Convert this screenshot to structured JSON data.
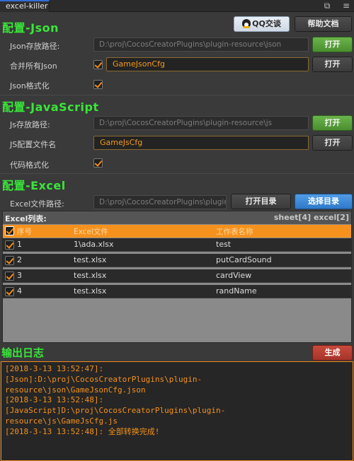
{
  "window": {
    "tab_title": "excel-killer"
  },
  "json_section": {
    "title": "配置-Json",
    "qq_button": "QQ交谈",
    "help_button": "帮助文档",
    "save_path_label": "Json存放路径:",
    "save_path_value": "D:\\proj\\CocosCreatorPlugins\\plugin-resource\\json",
    "open_button": "打开",
    "merge_label": "合并所有Json",
    "merge_name_value": "GameJsonCfg",
    "open_button_2": "打开",
    "format_label": "Json格式化"
  },
  "js_section": {
    "title": "配置-JavaScript",
    "save_path_label": "Js存放路径:",
    "save_path_value": "D:\\proj\\CocosCreatorPlugins\\plugin-resource\\js",
    "open_button": "打开",
    "config_name_label": "JS配置文件名",
    "config_name_value": "GameJsCfg",
    "open_button_2": "打开",
    "format_label": "代码格式化"
  },
  "excel_section": {
    "title": "配置-Excel",
    "path_label": "Excel文件路径:",
    "path_value": "D:\\proj\\CocosCreatorPlugins\\plugin-resource\\doc",
    "open_dir_button": "打开目录",
    "select_dir_button": "选择目录",
    "list_title": "Excel列表:",
    "counts": "sheet[4] excel[2]",
    "columns": {
      "index": "序号",
      "file": "Excel文件",
      "sheet": "工作表名称"
    },
    "rows": [
      {
        "index": "1",
        "file": "1\\ada.xlsx",
        "sheet": "test"
      },
      {
        "index": "2",
        "file": "test.xlsx",
        "sheet": "putCardSound"
      },
      {
        "index": "3",
        "file": "test.xlsx",
        "sheet": "cardView"
      },
      {
        "index": "4",
        "file": "test.xlsx",
        "sheet": "randName"
      }
    ]
  },
  "log": {
    "title": "输出日志",
    "generate_button": "生成",
    "lines": [
      "[2018-3-13 13:52:47]:",
      "[Json]:D:\\proj\\CocosCreatorPlugins\\plugin-",
      "resource\\json\\GameJsonCfg.json",
      "[2018-3-13 13:52:48]:",
      "[JavaScript]D:\\proj\\CocosCreatorPlugins\\plugin-",
      "resource\\js\\GameJsCfg.js",
      "[2018-3-13 13:52:48]: 全部转换完成!"
    ]
  },
  "colors": {
    "accent_green": "#39e639",
    "accent_orange": "#f5921d",
    "tab_blue": "#2f6fd6"
  }
}
